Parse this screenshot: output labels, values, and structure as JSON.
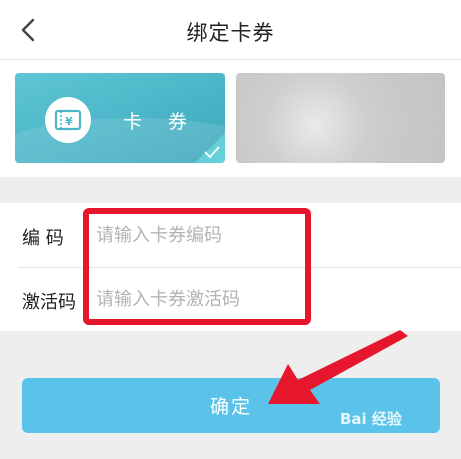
{
  "header": {
    "title": "绑定卡券",
    "back_icon": "chevron-left-icon"
  },
  "cards": {
    "coupon_label": "卡 券",
    "coupon_icon": "ticket-yen-icon",
    "coupon_selected": true,
    "accent_color": "#4bb7c9"
  },
  "form": {
    "code": {
      "label": "编 码",
      "placeholder": "请输入卡券编码"
    },
    "activation": {
      "label": "激活码",
      "placeholder": "请输入卡券激活码"
    }
  },
  "confirm_button": {
    "label": "确定",
    "color": "#5bc3ea"
  },
  "annotation": {
    "highlight_color": "#e6172c"
  },
  "watermark": {
    "text": "Bai 经验"
  }
}
